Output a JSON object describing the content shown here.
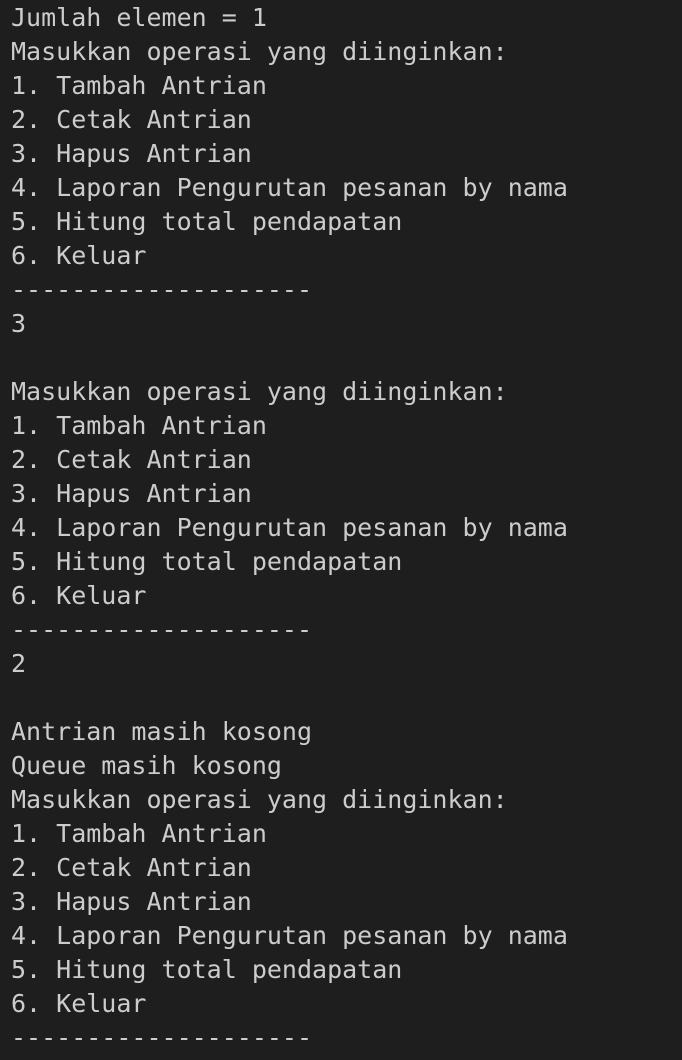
{
  "terminal": {
    "lines": [
      "Jumlah elemen = 1",
      "Masukkan operasi yang diinginkan:",
      "1. Tambah Antrian",
      "2. Cetak Antrian",
      "3. Hapus Antrian",
      "4. Laporan Pengurutan pesanan by nama",
      "5. Hitung total pendapatan",
      "6. Keluar",
      "--------------------",
      "3",
      "",
      "Masukkan operasi yang diinginkan:",
      "1. Tambah Antrian",
      "2. Cetak Antrian",
      "3. Hapus Antrian",
      "4. Laporan Pengurutan pesanan by nama",
      "5. Hitung total pendapatan",
      "6. Keluar",
      "--------------------",
      "2",
      "",
      "Antrian masih kosong",
      "Queue masih kosong",
      "Masukkan operasi yang diinginkan:",
      "1. Tambah Antrian",
      "2. Cetak Antrian",
      "3. Hapus Antrian",
      "4. Laporan Pengurutan pesanan by nama",
      "5. Hitung total pendapatan",
      "6. Keluar",
      "--------------------"
    ]
  }
}
